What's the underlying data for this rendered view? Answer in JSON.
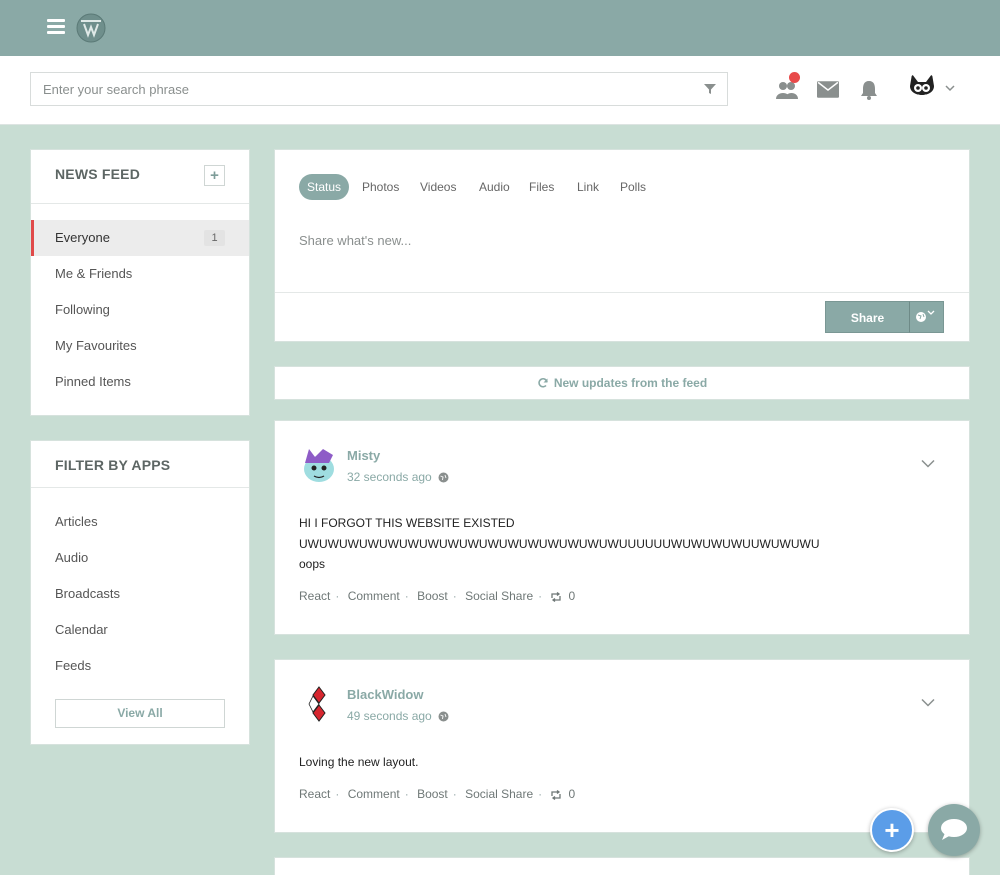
{
  "header": {
    "search_placeholder": "Enter your search phrase"
  },
  "news_feed": {
    "title": "NEWS FEED",
    "items": [
      {
        "label": "Everyone",
        "badge": "1"
      },
      {
        "label": "Me & Friends"
      },
      {
        "label": "Following"
      },
      {
        "label": "My Favourites"
      },
      {
        "label": "Pinned Items"
      }
    ]
  },
  "filter_apps": {
    "title": "FILTER BY APPS",
    "items": [
      "Articles",
      "Audio",
      "Broadcasts",
      "Calendar",
      "Feeds"
    ],
    "view_all": "View All"
  },
  "composer": {
    "tabs": [
      "Status",
      "Photos",
      "Videos",
      "Audio",
      "Files",
      "Link",
      "Polls"
    ],
    "placeholder": "Share what's new...",
    "share_label": "Share"
  },
  "updates_label": "New updates from the feed",
  "posts": [
    {
      "author": "Misty",
      "time": "32 seconds ago",
      "body_lines": [
        "HI I FORGOT THIS WEBSITE EXISTED",
        "UWUWUWUWUWUWUWUWUWUWUWUWUWUWUWUWUUUUUUWUWUWUWUUWUWUWU",
        "oops"
      ],
      "actions": {
        "react": "React",
        "comment": "Comment",
        "boost": "Boost",
        "social_share": "Social Share",
        "boost_count": "0"
      }
    },
    {
      "author": "BlackWidow",
      "time": "49 seconds ago",
      "body_lines": [
        "Loving the new layout."
      ],
      "actions": {
        "react": "React",
        "comment": "Comment",
        "boost": "Boost",
        "social_share": "Social Share",
        "boost_count": "0"
      }
    }
  ],
  "colors": {
    "accent": "#8aa9a6",
    "background": "#c8ddd3",
    "notification": "#e84a4a",
    "fab_blue": "#5b9de8"
  },
  "icons": [
    "menu-icon",
    "logo-icon",
    "filter-icon",
    "friends-icon",
    "envelope-icon",
    "bell-icon",
    "chevron-down-icon",
    "globe-icon",
    "refresh-icon",
    "repost-icon",
    "plus-icon",
    "chat-icon"
  ]
}
